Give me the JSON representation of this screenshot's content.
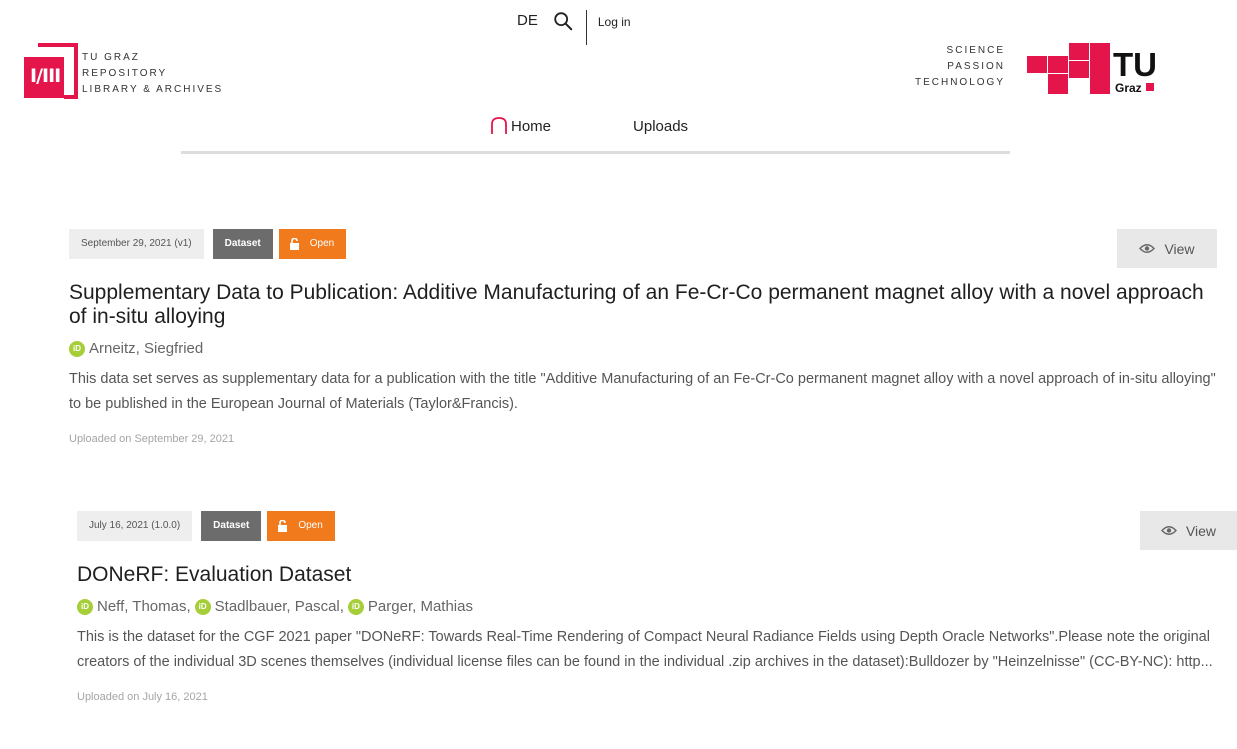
{
  "header": {
    "language": "DE",
    "login": "Log in",
    "repo_logo": {
      "mark_text": "I/III",
      "lines": [
        "TU GRAZ",
        "REPOSITORY",
        "LIBRARY & ARCHIVES"
      ]
    },
    "slogan": [
      "SCIENCE",
      "PASSION",
      "TECHNOLOGY"
    ],
    "tu_logo": {
      "letters": "TU",
      "sub": "Graz"
    }
  },
  "nav": {
    "home": "Home",
    "uploads": "Uploads"
  },
  "records": [
    {
      "date_version": "September 29, 2021 (v1)",
      "type": "Dataset",
      "access": "Open",
      "title": "Supplementary Data to Publication: Additive Manufacturing of an Fe-Cr-Co permanent magnet alloy with a novel approach of in-situ alloying",
      "creators": [
        "Arneitz, Siegfried"
      ],
      "description": "This data set serves as supplementary data for a publication with the title \"Additive Manufacturing of an Fe-Cr-Co permanent magnet alloy with a novel approach of in-situ alloying\" to be published in the European Journal of Materials (Taylor&Francis).",
      "uploaded": "Uploaded on September 29, 2021",
      "view": "View"
    },
    {
      "date_version": "July 16, 2021 (1.0.0)",
      "type": "Dataset",
      "access": "Open",
      "title": "DONeRF: Evaluation Dataset",
      "creators": [
        "Neff, Thomas,",
        "Stadlbauer, Pascal,",
        "Parger, Mathias"
      ],
      "description": "This is the dataset for the CGF 2021 paper \"DONeRF: Towards Real-Time Rendering of Compact Neural Radiance Fields using Depth Oracle Networks\".Please note the original creators of the individual 3D scenes themselves (individual license files can be found in the individual .zip archives in the dataset):Bulldozer by \"Heinzelnisse\" (CC-BY-NC): http...",
      "uploaded": "Uploaded on July 16, 2021",
      "view": "View"
    }
  ],
  "colors": {
    "brand_red": "#e4154b",
    "open_orange": "#f07a1c",
    "orcid_green": "#a6ce39",
    "type_gray": "#6c6c6c"
  }
}
